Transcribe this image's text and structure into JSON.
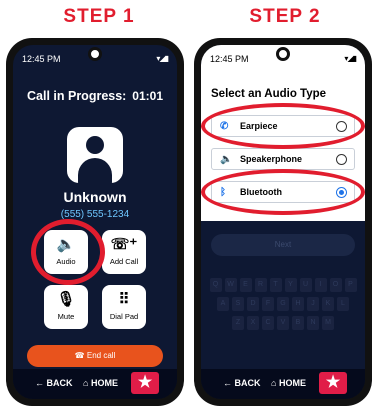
{
  "step1": "STEP 1",
  "step2": "STEP 2",
  "left": {
    "status_time": "12:45 PM",
    "call_title": "Call in Progress:",
    "call_timer": "01:01",
    "contact_name": "Unknown",
    "contact_number": "(555) 555-1234",
    "buttons": [
      {
        "label": "Audio",
        "icon": "speaker-icon",
        "glyph": "🔈"
      },
      {
        "label": "Add Call",
        "icon": "add-call-icon",
        "glyph": "☏⁺"
      },
      {
        "label": "Mute",
        "icon": "mic-off-icon",
        "glyph": "🎙"
      },
      {
        "label": "Dial Pad",
        "icon": "dialpad-icon",
        "glyph": "⠿"
      }
    ],
    "end_call": "End call",
    "end_icon": "☎"
  },
  "right": {
    "status_time": "12:45 PM",
    "sheet_title": "Select an Audio Type",
    "options": [
      {
        "label": "Earpiece",
        "icon": "phone-icon",
        "glyph": "✆",
        "selected": false
      },
      {
        "label": "Speakerphone",
        "icon": "speaker-icon",
        "glyph": "🔈",
        "selected": false
      },
      {
        "label": "Bluetooth",
        "icon": "bluetooth-icon",
        "glyph": "ᛒ",
        "selected": true
      }
    ],
    "next_label": "Next"
  },
  "nav": {
    "back": "BACK",
    "home": "HOME",
    "back_glyph": "←",
    "home_glyph": "⌂",
    "fav_glyph": "★"
  },
  "keyboard": [
    [
      "Q",
      "W",
      "E",
      "R",
      "T",
      "Y",
      "U",
      "I",
      "O",
      "P"
    ],
    [
      "A",
      "S",
      "D",
      "F",
      "G",
      "H",
      "J",
      "K",
      "L"
    ],
    [
      "Z",
      "X",
      "C",
      "V",
      "B",
      "N",
      "M"
    ]
  ],
  "colors": {
    "step": "#e11d2e",
    "screen_bg": "#0e1833",
    "accent": "#1e73e8",
    "end_call": "#e8531d",
    "ring": "#e11d2e"
  }
}
